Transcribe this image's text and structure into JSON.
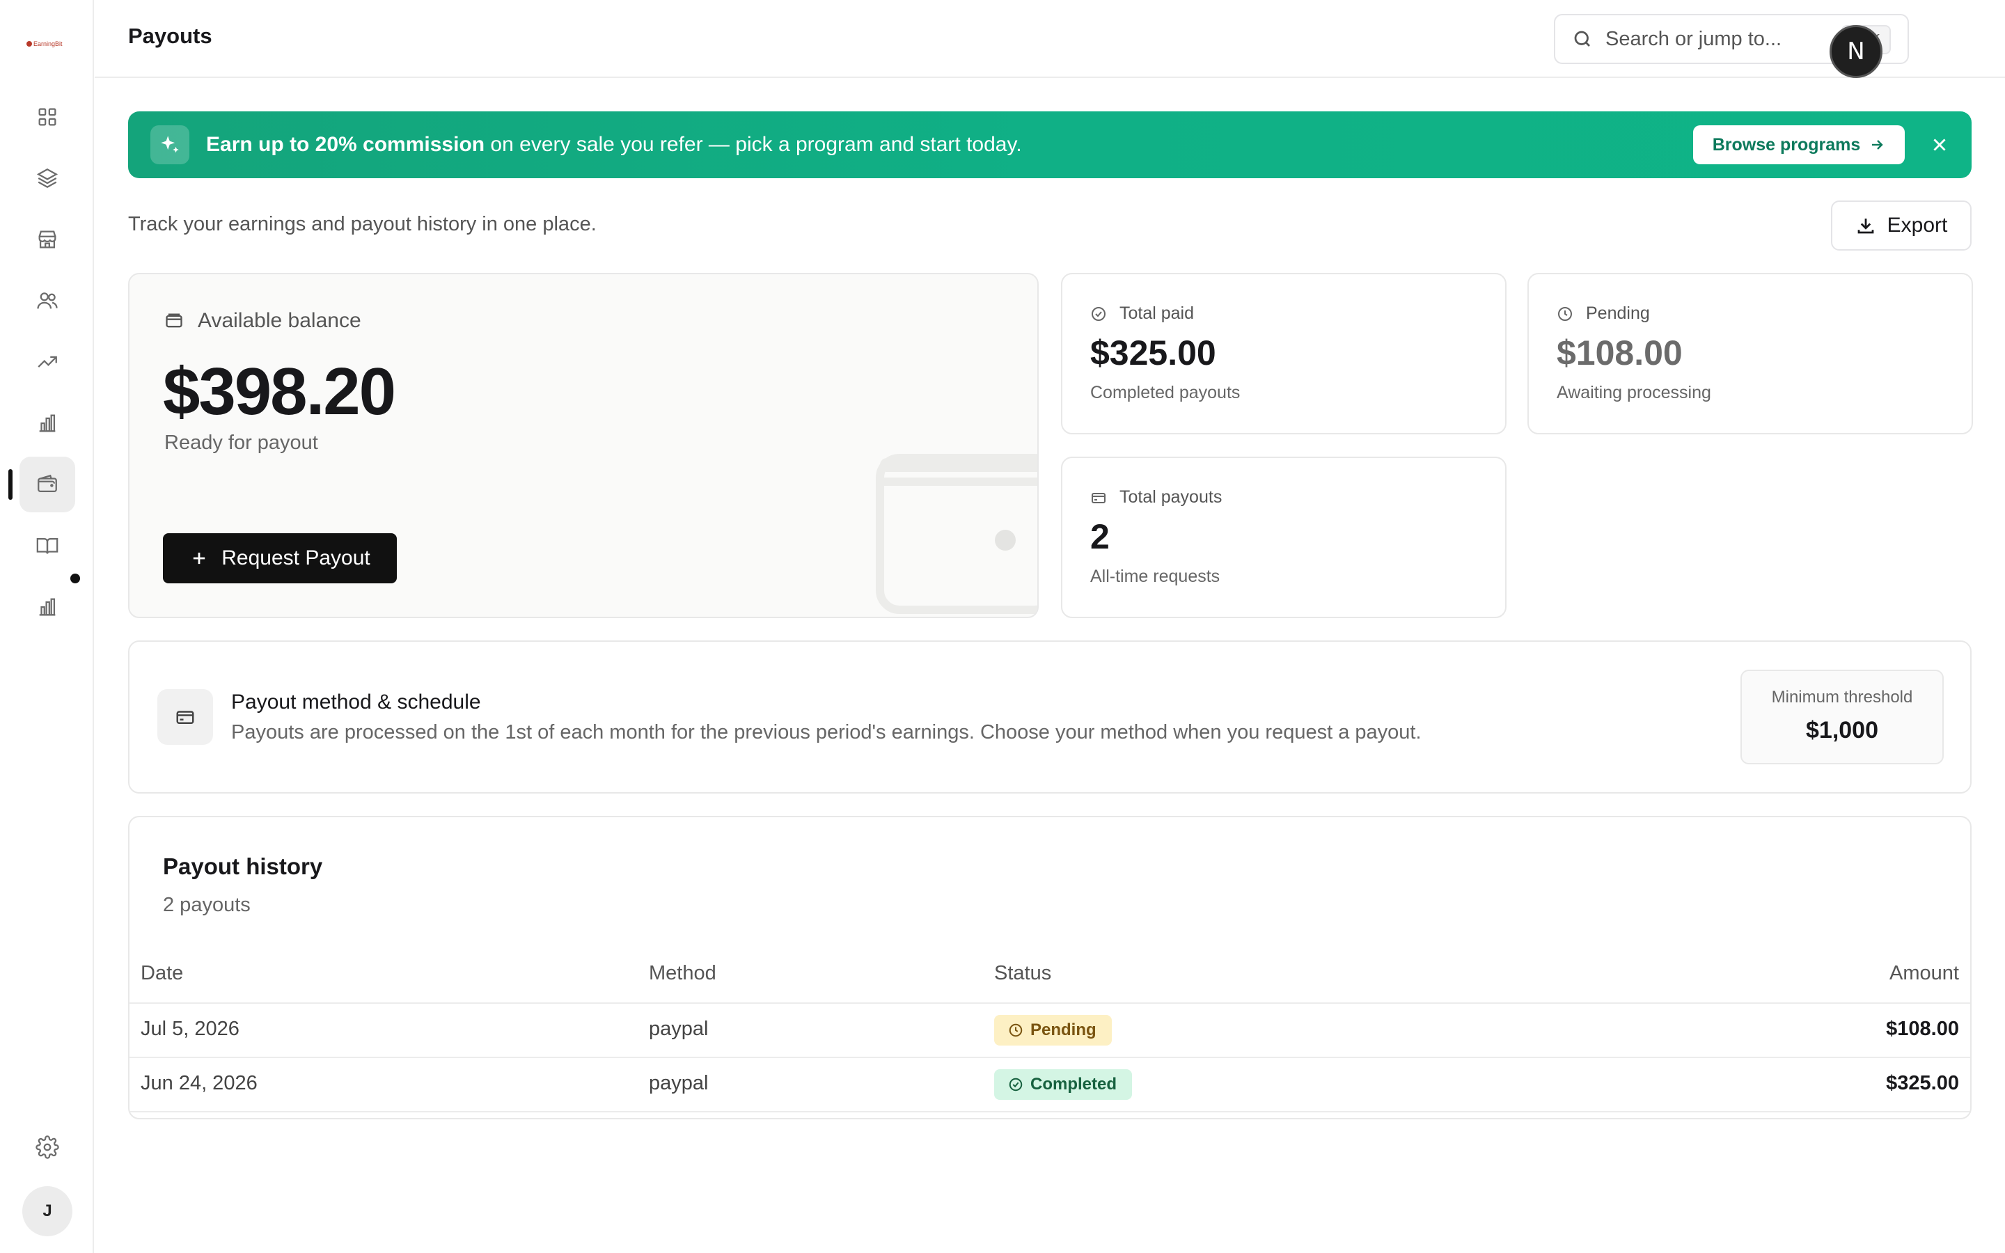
{
  "app": {
    "logo_text": "EarningBit"
  },
  "sidebar": {
    "items": [
      {
        "name": "dashboard",
        "icon": "grid-icon"
      },
      {
        "name": "programs",
        "icon": "layers-icon"
      },
      {
        "name": "marketplace",
        "icon": "store-icon"
      },
      {
        "name": "referrals",
        "icon": "users-icon"
      },
      {
        "name": "growth",
        "icon": "trending-up-icon"
      },
      {
        "name": "reports",
        "icon": "bar-chart-icon"
      },
      {
        "name": "payouts",
        "icon": "wallet-icon",
        "active": true
      },
      {
        "name": "resources",
        "icon": "book-open-icon"
      },
      {
        "name": "analytics",
        "icon": "bar-chart-icon"
      }
    ],
    "settings_icon": "gear-icon",
    "user_initial": "J"
  },
  "header": {
    "title": "Payouts",
    "search_placeholder": "Search or jump to...",
    "search_shortcut": "⌘ K",
    "avatar_initial": "N"
  },
  "banner": {
    "bold_text": "Earn up to 20% commission",
    "text": " on every sale you refer — pick a program and start today.",
    "button_label": "Browse programs",
    "accent": "#10b086"
  },
  "page": {
    "subtitle": "Track your earnings and payout history in one place.",
    "export_label": "Export"
  },
  "balance": {
    "label": "Available balance",
    "value": "$398.20",
    "sub": "Ready for payout",
    "button_label": "Request Payout"
  },
  "stats": {
    "total_paid": {
      "label": "Total paid",
      "value": "$325.00",
      "sub": "Completed payouts"
    },
    "pending": {
      "label": "Pending",
      "value": "$108.00",
      "sub": "Awaiting processing"
    },
    "total_payouts": {
      "label": "Total payouts",
      "value": "2",
      "sub": "All-time requests"
    }
  },
  "method": {
    "title": "Payout method & schedule",
    "description": "Payouts are processed on the 1st of each month for the previous period's earnings. Choose your method when you request a payout.",
    "threshold_label": "Minimum threshold",
    "threshold_value": "$1,000"
  },
  "history": {
    "title": "Payout history",
    "count": "2 payouts",
    "columns": [
      "Date",
      "Method",
      "Status",
      "Amount"
    ],
    "rows": [
      {
        "date": "Jul 5, 2026",
        "method": "paypal",
        "status": "Pending",
        "amount": "$108.00"
      },
      {
        "date": "Jun 24, 2026",
        "method": "paypal",
        "status": "Completed",
        "amount": "$325.00"
      }
    ],
    "status_colors": {
      "pending": "#fdf0c4",
      "completed": "#d4f5e4"
    }
  }
}
